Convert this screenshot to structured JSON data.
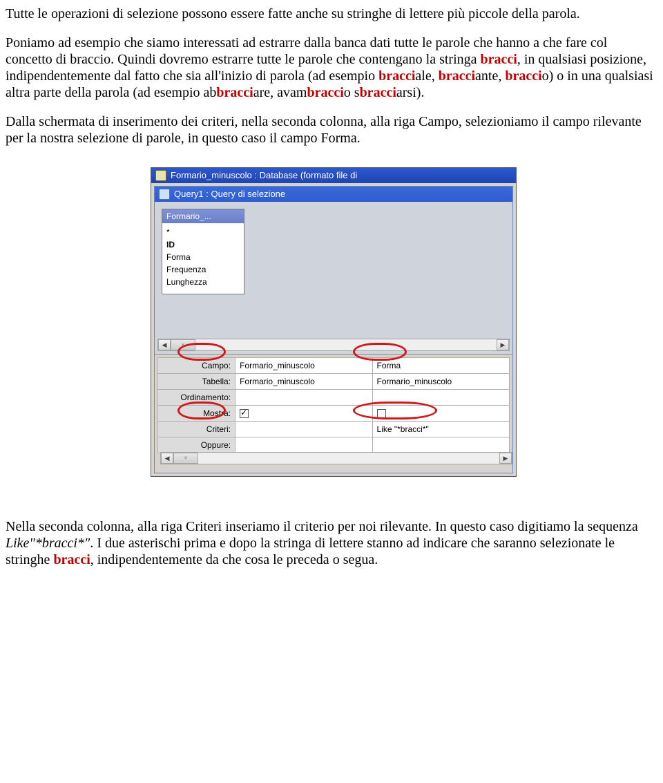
{
  "para1": {
    "t1": "Tutte le operazioni di selezione possono essere fatte anche su stringhe di lettere più piccole della parola."
  },
  "para2": {
    "t1": "Poniamo ad esempio che siamo interessati ad estrarre dalla banca dati tutte le parole che hanno a che fare col concetto di braccio. Quindi dovremo estrarre tutte le parole che contengano la stringa ",
    "h1": "bracci",
    "t2": ", in qualsiasi posizione, indipendentemente dal fatto che sia all'inizio di parola (ad esempio ",
    "h2": "bracci",
    "t3": "ale, ",
    "h3": "bracci",
    "t4": "ante, ",
    "h4": "bracci",
    "t5": "o) o in una qualsiasi altra parte della parola (ad esempio ab",
    "h5": "bracci",
    "t6": "are, avam",
    "h6": "bracci",
    "t7": "o s",
    "h7": "bracci",
    "t8": "arsi)."
  },
  "para3": "Dalla schermata di inserimento dei criteri, nella seconda colonna, alla riga Campo, selezioniamo il campo rilevante per la nostra selezione di parole, in questo caso il campo Forma.",
  "para4": {
    "t1": "Nella seconda colonna, alla riga Criteri inseriamo il criterio per noi rilevante. In questo caso digitiamo la sequenza ",
    "i1": "Like\"*bracci*\"",
    "t2": ". I due asterischi prima e dopo la stringa di lettere stanno ad indicare che saranno selezionate le stringhe ",
    "h1": "bracci",
    "t3": ", indipendentemente da che cosa le preceda o segua."
  },
  "shot": {
    "outerTitle": "Formario_minuscolo : Database (formato file di",
    "innerTitle": "Query1 : Query di selezione",
    "fieldBoxHeader": "Formario_...",
    "fields": {
      "star": "*",
      "id": "ID",
      "forma": "Forma",
      "freq": "Frequenza",
      "lung": "Lunghezza"
    },
    "rows": {
      "campo": "Campo:",
      "tabella": "Tabella:",
      "ordinamento": "Ordinamento:",
      "mostra": "Mostra:",
      "criteri": "Criteri:",
      "oppure": "Oppure:"
    },
    "col1": {
      "campo": "Formario_minuscolo",
      "tabella": "Formario_minuscolo"
    },
    "col2": {
      "campo": "Forma",
      "tabella": "Formario_minuscolo",
      "criteri": "Like \"*bracci*\""
    }
  }
}
